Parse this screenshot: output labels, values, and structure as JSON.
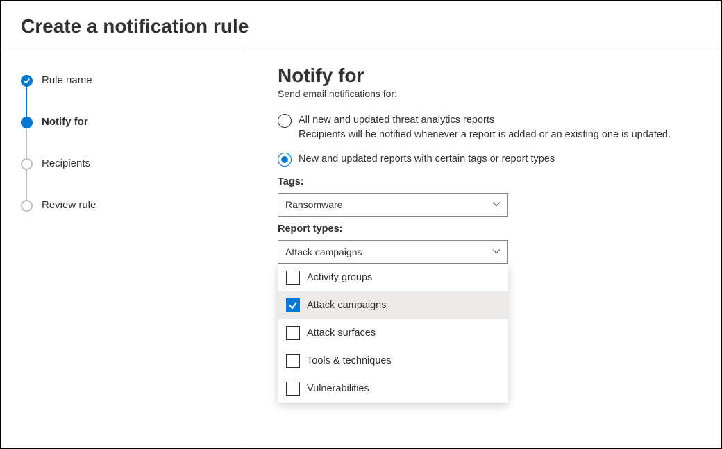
{
  "header": {
    "title": "Create a notification rule"
  },
  "steps": [
    {
      "label": "Rule name",
      "state": "done"
    },
    {
      "label": "Notify for",
      "state": "current"
    },
    {
      "label": "Recipients",
      "state": "todo"
    },
    {
      "label": "Review rule",
      "state": "todo"
    }
  ],
  "main": {
    "title": "Notify for",
    "subtitle": "Send email notifications for:",
    "radios": [
      {
        "label": "All new and updated threat analytics reports",
        "desc": "Recipients will be notified whenever a report is added or an existing one is updated.",
        "selected": false
      },
      {
        "label": "New and updated reports with certain tags or report types",
        "desc": "",
        "selected": true
      }
    ],
    "tags_label": "Tags:",
    "tags_value": "Ransomware",
    "report_types_label": "Report types:",
    "report_types_value": "Attack campaigns",
    "report_type_options": [
      {
        "label": "Activity groups",
        "selected": false
      },
      {
        "label": "Attack campaigns",
        "selected": true
      },
      {
        "label": "Attack surfaces",
        "selected": false
      },
      {
        "label": "Tools & techniques",
        "selected": false
      },
      {
        "label": "Vulnerabilities",
        "selected": false
      }
    ]
  }
}
